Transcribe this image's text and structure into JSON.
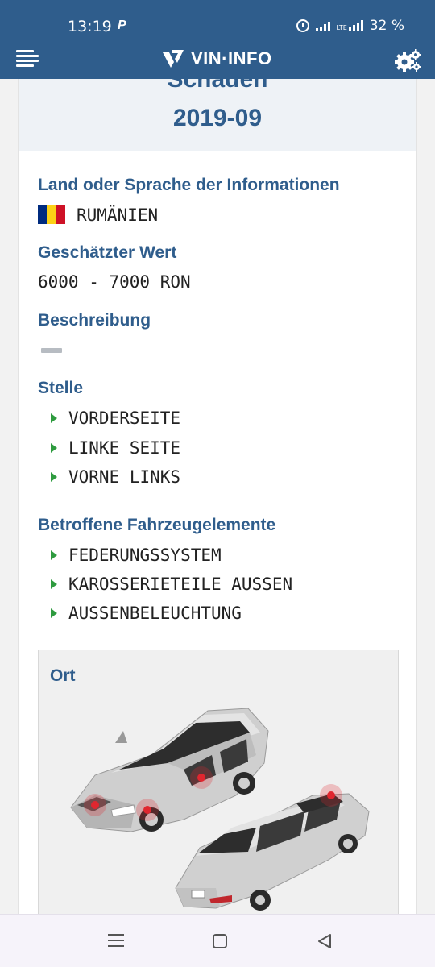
{
  "status_bar": {
    "time": "13:19",
    "battery": "32 %"
  },
  "app": {
    "brand": "VIN·INFO"
  },
  "header": {
    "partial_title": "Schaden",
    "date": "2019-09"
  },
  "country": {
    "label": "Land oder Sprache der Informationen",
    "value": "RUMÄNIEN",
    "flag_colors": [
      "#002b7f",
      "#fcd116",
      "#ce1126"
    ]
  },
  "estimated_value": {
    "label": "Geschätzter Wert",
    "value": "6000 - 7000 RON"
  },
  "description": {
    "label": "Beschreibung"
  },
  "location": {
    "label": "Stelle",
    "items": [
      "VORDERSEITE",
      "LINKE SEITE",
      "VORNE LINKS"
    ]
  },
  "affected": {
    "label": "Betroffene Fahrzeugelemente",
    "items": [
      "FEDERUNGSSYSTEM",
      "KAROSSERIETEILE AUSSEN",
      "AUSSENBELEUCHTUNG"
    ]
  },
  "place": {
    "label": "Ort"
  },
  "colors": {
    "primary": "#2f5d8c",
    "bullet": "#2e9b3f",
    "damage": "#e0262f"
  }
}
